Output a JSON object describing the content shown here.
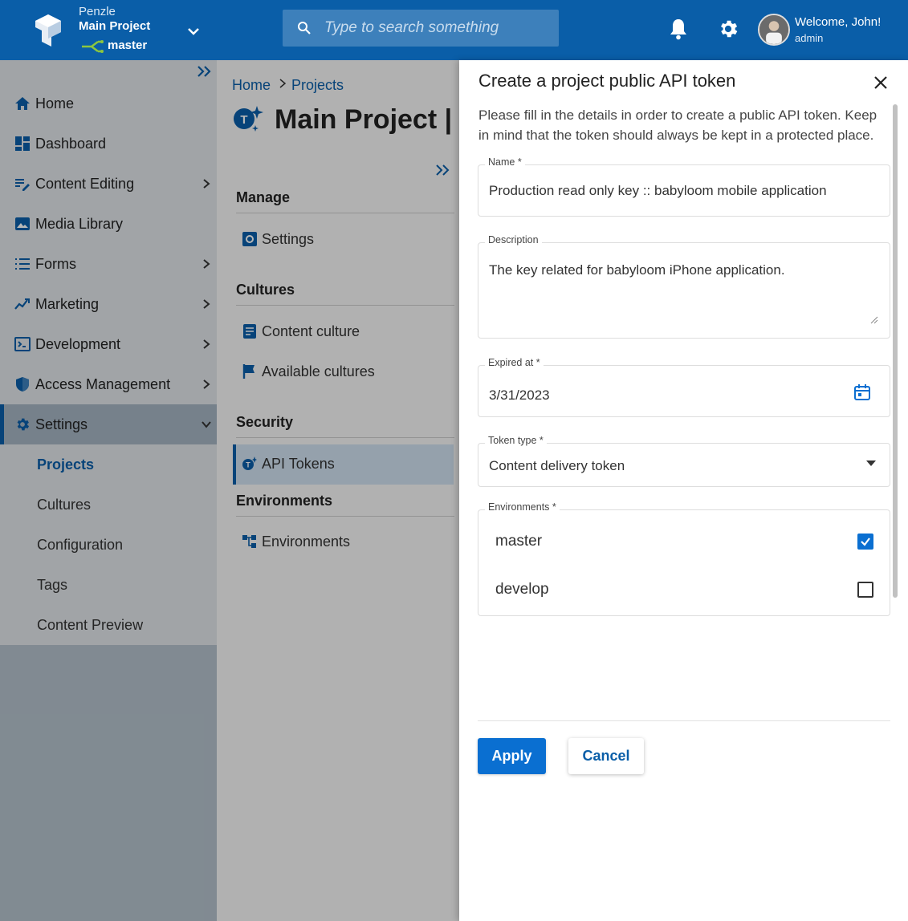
{
  "header": {
    "org": "Penzle",
    "project": "Main Project",
    "branch": "master",
    "search_placeholder": "Type to search something",
    "welcome": "Welcome, John!",
    "role": "admin"
  },
  "sidebar": {
    "items": [
      {
        "label": "Home",
        "icon": "home-icon"
      },
      {
        "label": "Dashboard",
        "icon": "dashboard-icon"
      },
      {
        "label": "Content Editing",
        "icon": "edit-icon"
      },
      {
        "label": "Media Library",
        "icon": "image-icon"
      },
      {
        "label": "Forms",
        "icon": "list-icon"
      },
      {
        "label": "Marketing",
        "icon": "trend-icon"
      },
      {
        "label": "Development",
        "icon": "terminal-icon"
      },
      {
        "label": "Access Management",
        "icon": "shield-icon"
      },
      {
        "label": "Settings",
        "icon": "gear-icon"
      }
    ],
    "sub_items": [
      "Projects",
      "Cultures",
      "Configuration",
      "Tags",
      "Content Preview"
    ]
  },
  "main": {
    "breadcrumb": [
      "Home",
      "Projects"
    ],
    "title": "Main Project | A",
    "sections": {
      "manage": "Manage",
      "settings": "Settings",
      "cultures": "Cultures",
      "content_culture": "Content culture",
      "available_cultures": "Available cultures",
      "security": "Security",
      "api_tokens": "API Tokens",
      "environments_header": "Environments",
      "environments": "Environments"
    }
  },
  "drawer": {
    "title": "Create a project public API token",
    "description": "Please fill in the details in order to create a public API token. Keep in mind that the token should always be kept in a protected place.",
    "name_label": "Name *",
    "name_value": "Production read only key :: babyloom mobile application",
    "description_label": "Description",
    "description_value": "The key related for babyloom iPhone application.",
    "expired_label": "Expired at *",
    "expired_value": "3/31/2023",
    "token_type_label": "Token type *",
    "token_type_value": "Content delivery token",
    "environments_label": "Environments *",
    "environments": [
      {
        "name": "master",
        "checked": true
      },
      {
        "name": "develop",
        "checked": false
      }
    ],
    "apply": "Apply",
    "cancel": "Cancel"
  },
  "colors": {
    "brand": "#0a5ea8",
    "accent": "#0a6fd1"
  }
}
